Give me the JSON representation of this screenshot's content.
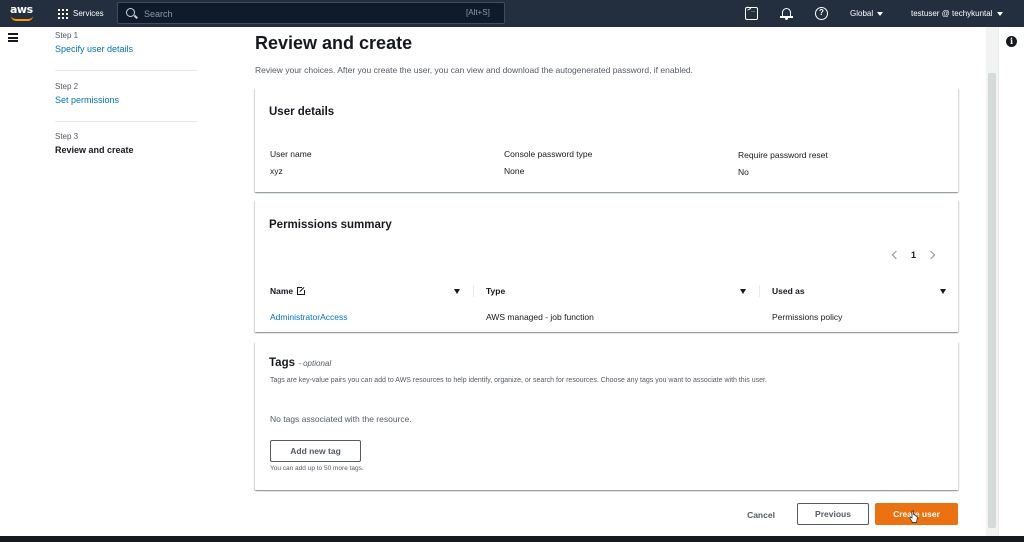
{
  "topnav": {
    "logo_text": "aws",
    "services_label": "Services",
    "search_placeholder": "Search",
    "search_shortcut": "[Alt+S]",
    "region_label": "Global",
    "user_label": "testuser @ techykuntal"
  },
  "steps": [
    {
      "num": "Step 1",
      "label": "Specify user details",
      "state": "link"
    },
    {
      "num": "Step 2",
      "label": "Set permissions",
      "state": "link"
    },
    {
      "num": "Step 3",
      "label": "Review and create",
      "state": "current"
    }
  ],
  "page": {
    "title": "Review and create",
    "description": "Review your choices. After you create the user, you can view and download the autogenerated password, if enabled."
  },
  "user_details": {
    "heading": "User details",
    "fields": [
      {
        "label": "User name",
        "value": "xyz"
      },
      {
        "label": "Console password type",
        "value": "None"
      },
      {
        "label": "Require password reset",
        "value": "No"
      }
    ]
  },
  "permissions": {
    "heading": "Permissions summary",
    "page_number": "1",
    "columns": [
      "Name",
      "Type",
      "Used as"
    ],
    "rows": [
      {
        "name": "AdministratorAccess",
        "type": "AWS managed - job function",
        "used_as": "Permissions policy"
      }
    ]
  },
  "tags": {
    "heading": "Tags",
    "optional": "- optional",
    "description": "Tags are key-value pairs you can add to AWS resources to help identify, organize, or search for resources. Choose any tags you want to associate with this user.",
    "empty_text": "No tags associated with the resource.",
    "add_button": "Add new tag",
    "hint": "You can add up to 50 more tags."
  },
  "actions": {
    "cancel": "Cancel",
    "previous": "Previous",
    "create": "Create user"
  },
  "colors": {
    "nav_bg": "#232f3e",
    "primary": "#ec7211",
    "link": "#0073bb",
    "aws_orange": "#ff9900"
  },
  "icons": [
    "grid-icon",
    "search-icon",
    "cloudshell-icon",
    "bell-icon",
    "help-icon",
    "caret-down-icon",
    "hamburger-icon",
    "external-link-icon",
    "sort-icon",
    "chevron-left-icon",
    "chevron-right-icon",
    "info-icon",
    "cursor-icon"
  ]
}
